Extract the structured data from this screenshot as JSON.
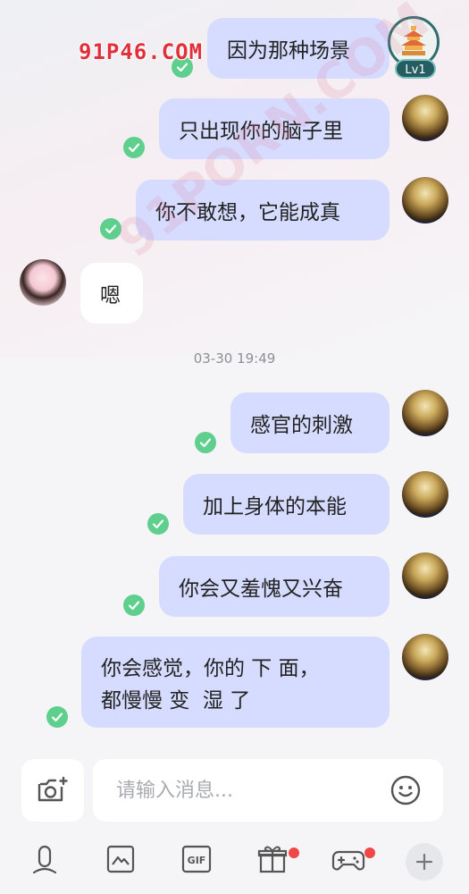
{
  "watermark": {
    "text": "91P46.COM"
  },
  "user_badge": {
    "level": "Lv1"
  },
  "messages": [
    {
      "side": "right",
      "text": "因为那种场景",
      "read": true
    },
    {
      "side": "right",
      "text": "只出现你的脑子里",
      "read": true
    },
    {
      "side": "right",
      "text": "你不敢想，它能成真",
      "read": true
    },
    {
      "side": "left",
      "text": "嗯",
      "read": false
    },
    {
      "side": "right",
      "text": "感官的刺激",
      "read": true
    },
    {
      "side": "right",
      "text": "加上身体的本能",
      "read": true
    },
    {
      "side": "right",
      "text": "你会又羞愧又兴奋",
      "read": true
    },
    {
      "side": "right",
      "text_line1": "你会感觉，你的 下 面，",
      "text_line2": "都慢慢 变  湿 了",
      "read": true
    }
  ],
  "timestamp": "03-30 19:49",
  "composer": {
    "placeholder": "请输入消息..."
  },
  "toolbar": {
    "items": [
      "voice-icon",
      "image-icon",
      "gif-icon",
      "gift-icon",
      "game-icon",
      "plus-icon"
    ],
    "gif_label": "GIF",
    "badges": {
      "gift": true,
      "game": true
    },
    "accent": "#ef4747"
  },
  "colors": {
    "bubble_mine": "#d6dcff",
    "bubble_theirs": "#ffffff",
    "read_check": "#5fcf8e"
  }
}
